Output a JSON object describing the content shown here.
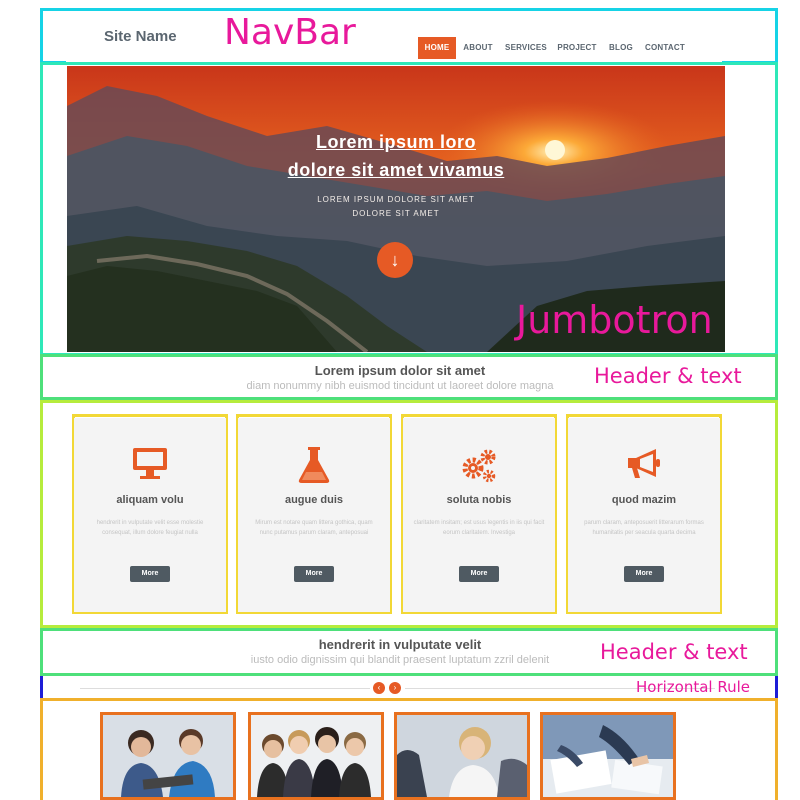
{
  "annotations": {
    "navbar": "NavBar",
    "jumbotron": "Jumbotron",
    "header_text_1": "Header & text",
    "header_text_2": "Header & text",
    "horizontal_rule": "Horizontal Rule"
  },
  "colors": {
    "accent_orange": "#e65a25",
    "photo_border": "#e8711f",
    "button_dark": "#4f5a62",
    "navbar_box": "#16d3e6",
    "jumbotron_box": "#2ee8b8",
    "header_box": "#4ee07a",
    "section_box": "#b6ec3c",
    "card_box": "#f2d836",
    "hr_box": "#1d1dd6",
    "photos_box": "#f0b02c",
    "label_pink": "#e8199b"
  },
  "navbar": {
    "site_name": "Site Name",
    "items": [
      "HOME",
      "ABOUT",
      "SERVICES",
      "PROJECT",
      "BLOG",
      "CONTACT"
    ],
    "active": "HOME"
  },
  "hero": {
    "title_line1": "Lorem ipsum loro",
    "title_line2": "dolore sit amet vivamus",
    "sub_line1": "LOREM IPSUM DOLORE SIT AMET",
    "sub_line2": "DOLORE SIT AMET",
    "arrow_icon": "arrow-down-icon"
  },
  "section1": {
    "title": "Lorem ipsum dolor sit amet",
    "text": "diam nonummy nibh euismod tincidunt ut laoreet dolore magna"
  },
  "cards": [
    {
      "icon": "monitor-icon",
      "title": "aliquam volu",
      "text": "hendrerit in vulputate velit esse molestie consequat, illum dolore feugiat nulla",
      "button": "More"
    },
    {
      "icon": "flask-icon",
      "title": "augue duis",
      "text": "Mirum est notare quam littera gothica, quam nunc putamus parum claram, anteposuai",
      "button": "More"
    },
    {
      "icon": "gears-icon",
      "title": "soluta nobis",
      "text": "claritatem insitam; est usus legentis in iis qui facit eorum claritatem. Investiga",
      "button": "More"
    },
    {
      "icon": "megaphone-icon",
      "title": "quod mazim",
      "text": "parum claram, anteposuerit litterarum formas humanitatis per seacula quarta decima",
      "button": "More"
    }
  ],
  "section2": {
    "title": "hendrerit in vulputate velit",
    "text": "iusto odio dignissim qui blandit praesent luptatum zzril delenit"
  },
  "hr": {
    "prev_icon": "chevron-left-icon",
    "next_icon": "chevron-right-icon"
  },
  "photos": [
    {
      "name": "team-photo-laptop"
    },
    {
      "name": "team-photo-group"
    },
    {
      "name": "team-photo-woman"
    },
    {
      "name": "team-photo-documents"
    }
  ]
}
